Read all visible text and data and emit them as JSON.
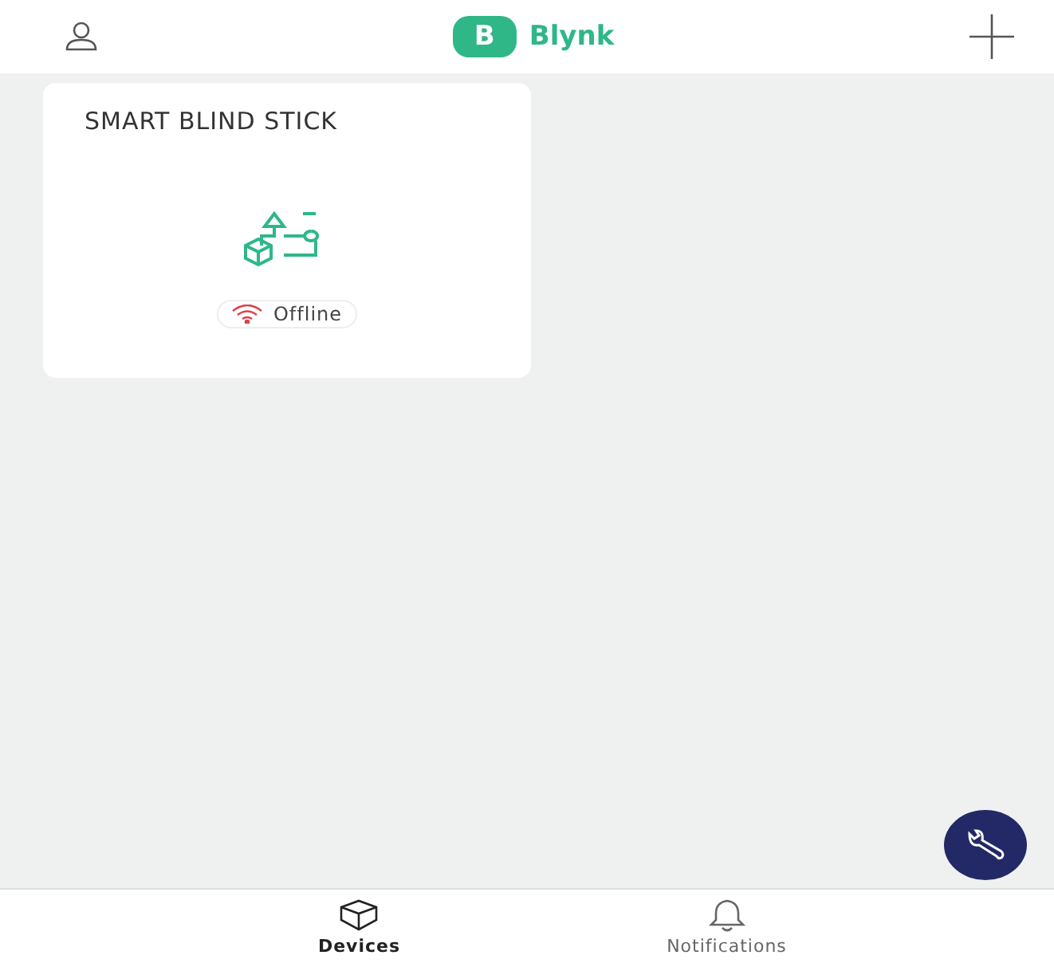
{
  "header": {
    "logo_letter": "B",
    "brand": "Blynk"
  },
  "devices": [
    {
      "name": "SMART BLIND STICK",
      "status": "Offline",
      "online": false
    }
  ],
  "tabs": [
    {
      "label": "Devices",
      "kind": "box",
      "selected": true
    },
    {
      "label": "Notifications",
      "kind": "bell",
      "selected": false
    }
  ]
}
